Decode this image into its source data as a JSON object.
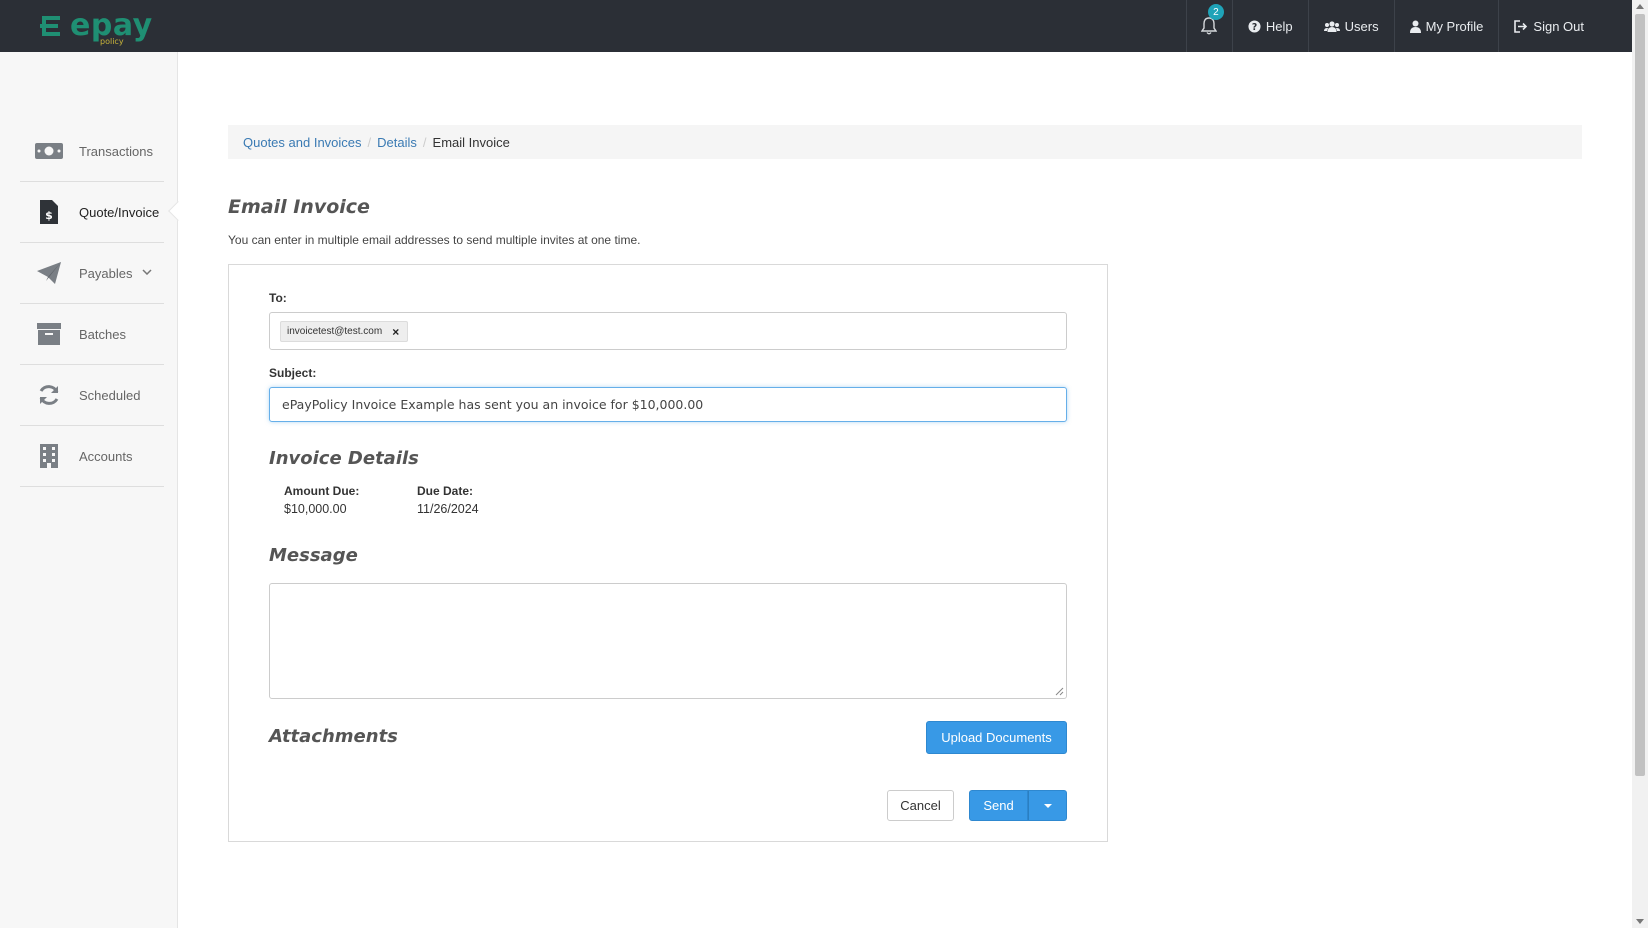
{
  "app": {
    "logo_text": "epay",
    "logo_sub": "policy"
  },
  "topnav": {
    "notification_count": "2",
    "help": "Help",
    "users": "Users",
    "profile": "My Profile",
    "signout": "Sign Out"
  },
  "sidebar": {
    "items": [
      {
        "label": "Transactions",
        "icon": "money-icon"
      },
      {
        "label": "Quote/Invoice",
        "icon": "invoice-icon"
      },
      {
        "label": "Payables",
        "icon": "paper-plane-icon"
      },
      {
        "label": "Batches",
        "icon": "archive-icon"
      },
      {
        "label": "Scheduled",
        "icon": "refresh-icon"
      },
      {
        "label": "Accounts",
        "icon": "building-icon"
      }
    ]
  },
  "breadcrumb": {
    "items": [
      "Quotes and Invoices",
      "Details"
    ],
    "current": "Email Invoice"
  },
  "page": {
    "title": "Email Invoice",
    "description": "You can enter in multiple email addresses to send multiple invites at one time."
  },
  "form": {
    "to_label": "To:",
    "to_recipient": "invoicetest@test.com",
    "to_remove": "×",
    "subject_label": "Subject:",
    "subject_value": "ePayPolicy Invoice Example has sent you an invoice for $10,000.00",
    "invoice_details_title": "Invoice Details",
    "amount_due_label": "Amount Due:",
    "amount_due_value": "$10,000.00",
    "due_date_label": "Due Date:",
    "due_date_value": "11/26/2024",
    "message_title": "Message",
    "message_value": "",
    "attachments_title": "Attachments",
    "upload_button": "Upload Documents",
    "cancel_button": "Cancel",
    "send_button": "Send"
  },
  "colors": {
    "topbar": "#2b2f36",
    "primary_button": "#3899e6",
    "link": "#3a7ab3",
    "logo": "#1f8f73"
  }
}
